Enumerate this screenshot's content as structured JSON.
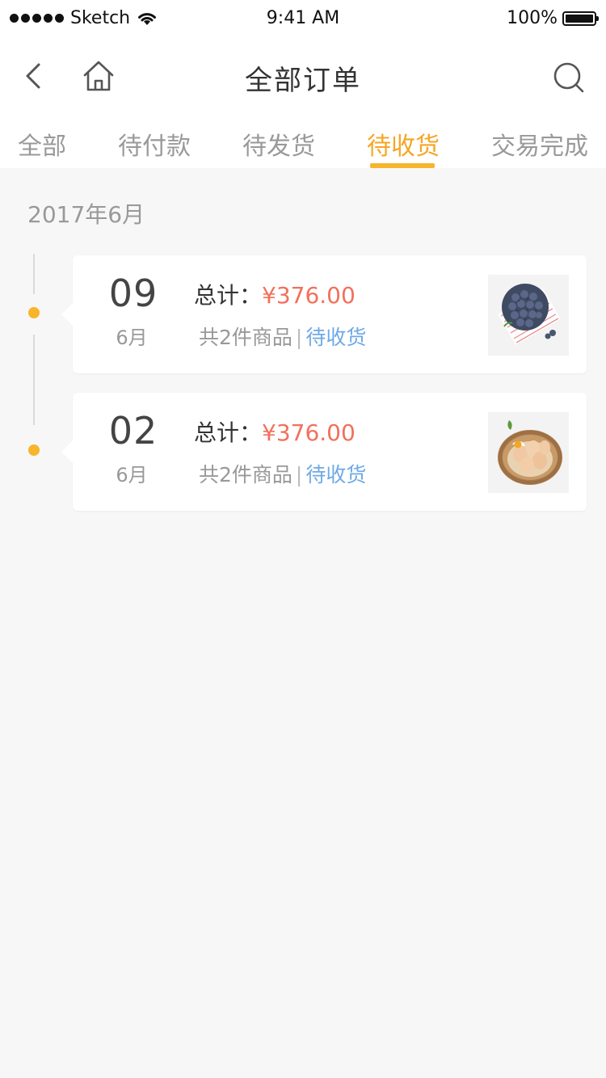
{
  "status_bar": {
    "carrier": "Sketch",
    "time": "9:41 AM",
    "battery": "100%"
  },
  "nav": {
    "title": "全部订单",
    "icons": [
      "back-icon",
      "home-icon",
      "search-icon"
    ]
  },
  "tabs": [
    {
      "label": "全部"
    },
    {
      "label": "待付款"
    },
    {
      "label": "待发货"
    },
    {
      "label": "待收货",
      "active": true
    },
    {
      "label": "交易完成"
    }
  ],
  "colors": {
    "accent": "#f5a623",
    "price": "#f2705b",
    "status_link": "#6fa9e6",
    "background": "#f7f7f7"
  },
  "month_group": "2017年6月",
  "orders": [
    {
      "day": "09",
      "month": "6月",
      "total_label": "总计：",
      "total_price": "¥376.00",
      "count": "共2件商品",
      "separator": "|",
      "status": "待收货",
      "thumb": "blueberries-image"
    },
    {
      "day": "02",
      "month": "6月",
      "total_label": "总计：",
      "total_price": "¥376.00",
      "count": "共2件商品",
      "separator": "|",
      "status": "待收货",
      "thumb": "eggs-basket-image"
    }
  ]
}
